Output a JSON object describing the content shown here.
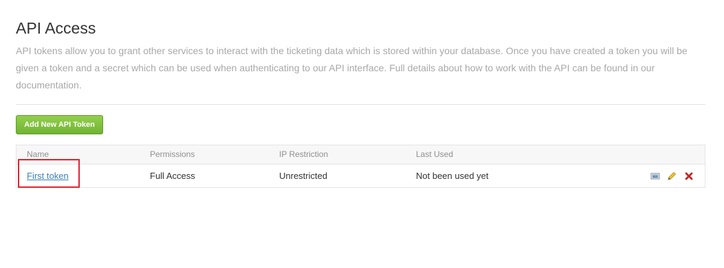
{
  "header": {
    "title": "API Access",
    "description": "API tokens allow you to grant other services to interact with the ticketing data which is stored within your database. Once you have created a token you will be given a token and a secret which can be used when authenticating to our API interface. Full details about how to work with the API can be found in our documentation."
  },
  "actions": {
    "add_button_label": "Add New API Token"
  },
  "table": {
    "columns": [
      "Name",
      "Permissions",
      "IP Restriction",
      "Last Used"
    ],
    "rows": [
      {
        "name": "First token",
        "permissions": "Full Access",
        "ip_restriction": "Unrestricted",
        "last_used": "Not been used yet",
        "row_actions": [
          "view-icon",
          "edit-pencil-icon",
          "delete-x-icon"
        ]
      }
    ]
  },
  "colors": {
    "button_green": "#7cbf3b",
    "link_blue": "#3a7fbd",
    "highlight_red": "#e0242e",
    "delete_red": "#cc2222"
  }
}
